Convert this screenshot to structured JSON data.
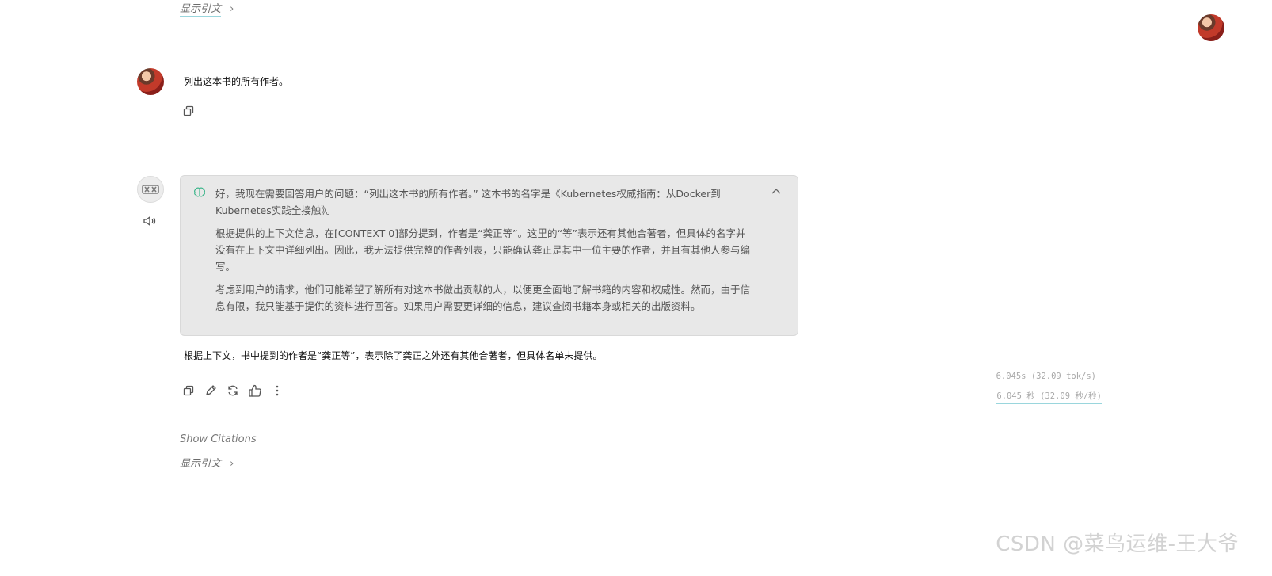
{
  "top_citation": {
    "label": "显示引文",
    "chevron": "›"
  },
  "user_message": {
    "text": "列出这本书的所有作者。"
  },
  "assistant": {
    "reasoning": [
      "好，我现在需要回答用户的问题：“列出这本书的所有作者。” 这本书的名字是《Kubernetes权威指南：从Docker到Kubernetes实践全接触》。",
      "根据提供的上下文信息，在[CONTEXT 0]部分提到，作者是“龚正等”。这里的“等”表示还有其他合著者，但具体的名字并没有在上下文中详细列出。因此，我无法提供完整的作者列表，只能确认龚正是其中一位主要的作者，并且有其他人参与编写。",
      "考虑到用户的请求，他们可能希望了解所有对这本书做出贡献的人，以便更全面地了解书籍的内容和权威性。然而，由于信息有限，我只能基于提供的资料进行回答。如果用户需要更详细的信息，建议查阅书籍本身或相关的出版资料。"
    ],
    "answer": "根据上下文，书中提到的作者是“龚正等”，表示除了龚正之外还有其他合著者，但具体名单未提供。",
    "stats_line1": "6.045s (32.09 tok/s)",
    "stats_line2": "6.045 秒 (32.09 秒/秒)"
  },
  "show_citations": {
    "label": "Show Citations"
  },
  "bottom_citation": {
    "label": "显示引文",
    "chevron": "›"
  },
  "watermark": "CSDN @菜鸟运维-王大爷",
  "colors": {
    "accent_underline": "#9ad6dd",
    "reason_bg": "#e8e8e8",
    "brain_icon": "#3bb58a"
  }
}
